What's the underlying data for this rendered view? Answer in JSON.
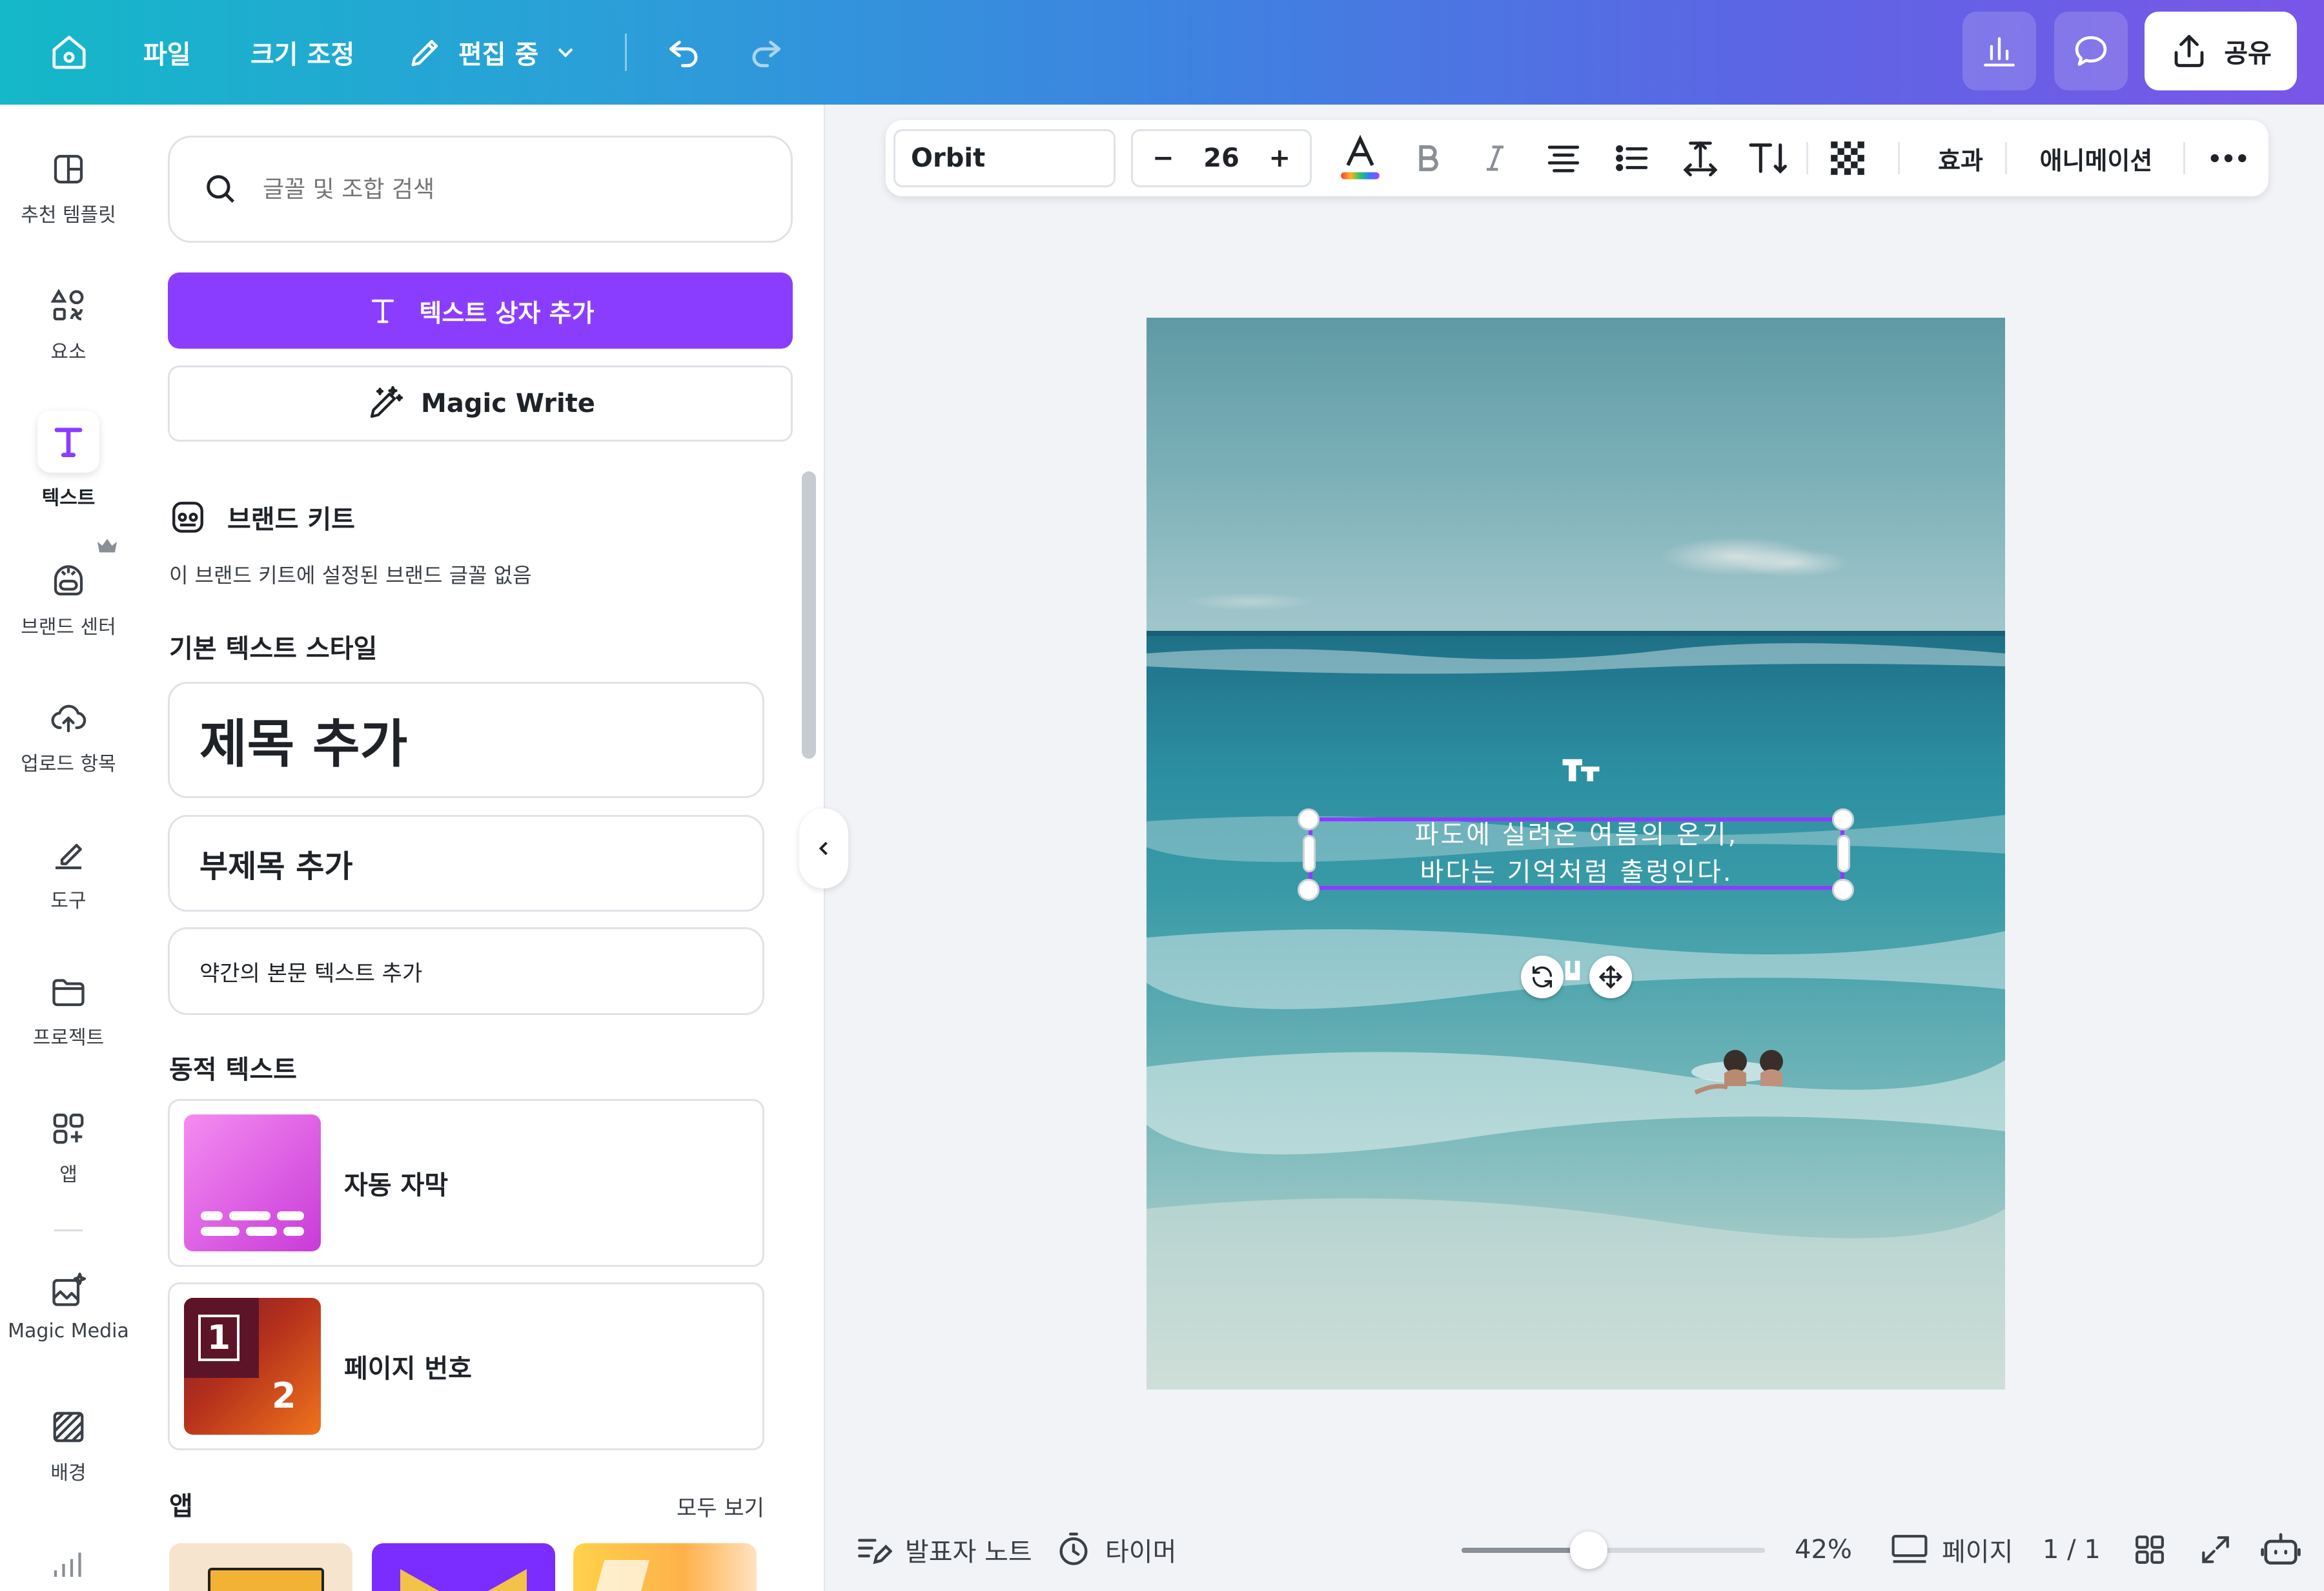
{
  "topbar": {
    "menu_file": "파일",
    "menu_resize": "크기 조정",
    "edit_mode": "편집 중",
    "share": "공유"
  },
  "rail": [
    {
      "label": "추천 템플릿",
      "icon": "template-icon"
    },
    {
      "label": "요소",
      "icon": "elements-icon"
    },
    {
      "label": "텍스트",
      "icon": "text-icon",
      "active": true
    },
    {
      "label": "브랜드 센터",
      "icon": "brand-icon"
    },
    {
      "label": "업로드 항목",
      "icon": "upload-icon"
    },
    {
      "label": "도구",
      "icon": "draw-icon"
    },
    {
      "label": "프로젝트",
      "icon": "folder-icon"
    },
    {
      "label": "앱",
      "icon": "apps-icon"
    },
    {
      "label": "Magic Media",
      "icon": "magic-media-icon"
    },
    {
      "label": "배경",
      "icon": "background-icon"
    }
  ],
  "panel": {
    "search_placeholder": "글꼴 및 조합 검색",
    "add_textbox": "텍스트 상자 추가",
    "magic_write": "Magic Write",
    "brand_kit_title": "브랜드 키트",
    "brand_kit_note": "이 브랜드 키트에 설정된 브랜드 글꼴 없음",
    "default_styles_title": "기본 텍스트 스타일",
    "heading": "제목 추가",
    "subheading": "부제목 추가",
    "body": "약간의 본문 텍스트 추가",
    "dynamic_title": "동적 텍스트",
    "auto_caption": "자동 자막",
    "page_number": "페이지 번호",
    "page_number_badge_1": "1",
    "page_number_badge_2": "2",
    "apps_title": "앱",
    "see_all": "모두 보기"
  },
  "toolbar": {
    "font": "Orbit",
    "size_minus": "−",
    "font_size": "26",
    "size_plus": "+",
    "effects": "효과",
    "animate": "애니메이션"
  },
  "canvas": {
    "caption_line1": "파도에 실려온 여름의 온기,",
    "caption_line2": "바다는 기억처럼 출렁인다.",
    "text_color": "#ffffff",
    "selection_color": "#8b3dff"
  },
  "bottombar": {
    "notes": "발표자 노트",
    "timer": "타이머",
    "zoom": "42%",
    "zoom_fraction": 0.42,
    "pages": "페이지",
    "page_indicator": "1 / 1"
  },
  "colors": {
    "accent": "#8b3dff",
    "topbar_start": "#14b8c8",
    "topbar_end": "#7a56e8"
  }
}
